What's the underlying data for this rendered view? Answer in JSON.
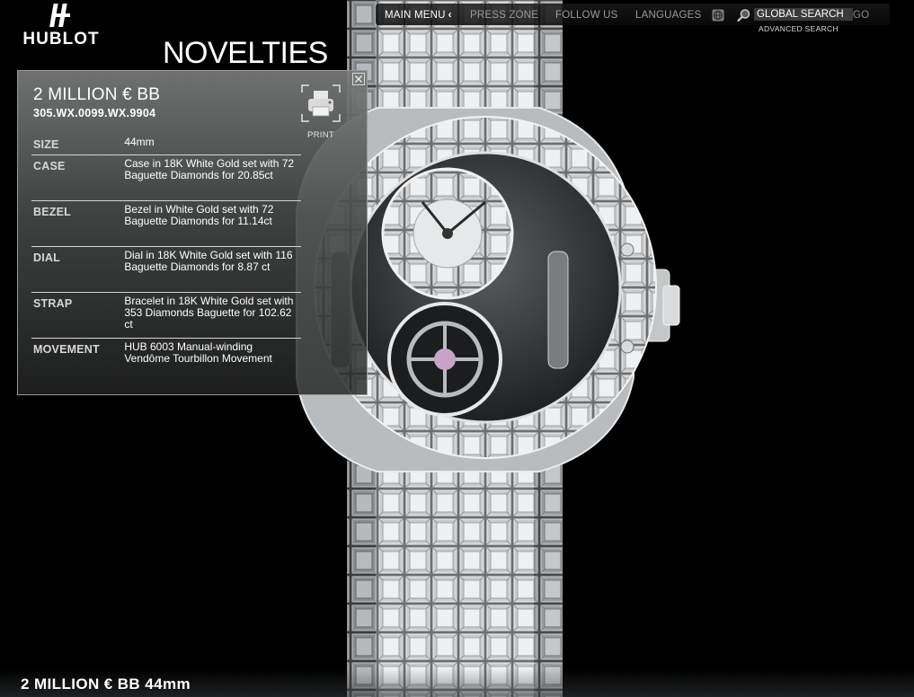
{
  "brand": {
    "name": "HUBLOT"
  },
  "page": {
    "title": "NOVELTIES"
  },
  "topnav": {
    "main_menu": "MAIN MENU",
    "press_zone": "PRESS ZONE",
    "follow_us": "FOLLOW US",
    "languages": "LANGUAGES",
    "search_value": "GLOBAL SEARCH",
    "go": "GO",
    "advanced_search": "ADVANCED SEARCH"
  },
  "product": {
    "name": "2 MILLION € BB",
    "reference": "305.WX.0099.WX.9904",
    "print_label": "PRINT",
    "specs": [
      {
        "key": "SIZE",
        "value": "44mm"
      },
      {
        "key": "CASE",
        "value": "Case in 18K White Gold set with 72 Baguette Diamonds for 20.85ct"
      },
      {
        "key": "BEZEL",
        "value": "Bezel in White Gold set with 72 Baguette Diamonds for 11.14ct"
      },
      {
        "key": "DIAL",
        "value": "Dial in 18K White Gold set with 116 Baguette Diamonds for 8.87 ct"
      },
      {
        "key": "STRAP",
        "value": "Bracelet in 18K White Gold set with 353 Diamonds Baguette for 102.62 ct"
      },
      {
        "key": "MOVEMENT",
        "value": "HUB 6003 Manual-winding Vendôme Tourbillon Movement"
      }
    ]
  },
  "footer": {
    "caption": "2 MILLION € BB 44mm"
  },
  "icons": {
    "logo": "hublot-logo-icon",
    "chevron": "chevron-left-icon",
    "globe": "globe-icon",
    "search": "magnifier-icon",
    "printer": "printer-icon",
    "close": "close-icon"
  },
  "colors": {
    "background": "#000000",
    "text": "#ffffff",
    "nav_muted": "#9a9a9a",
    "panel": "#6e7070"
  }
}
